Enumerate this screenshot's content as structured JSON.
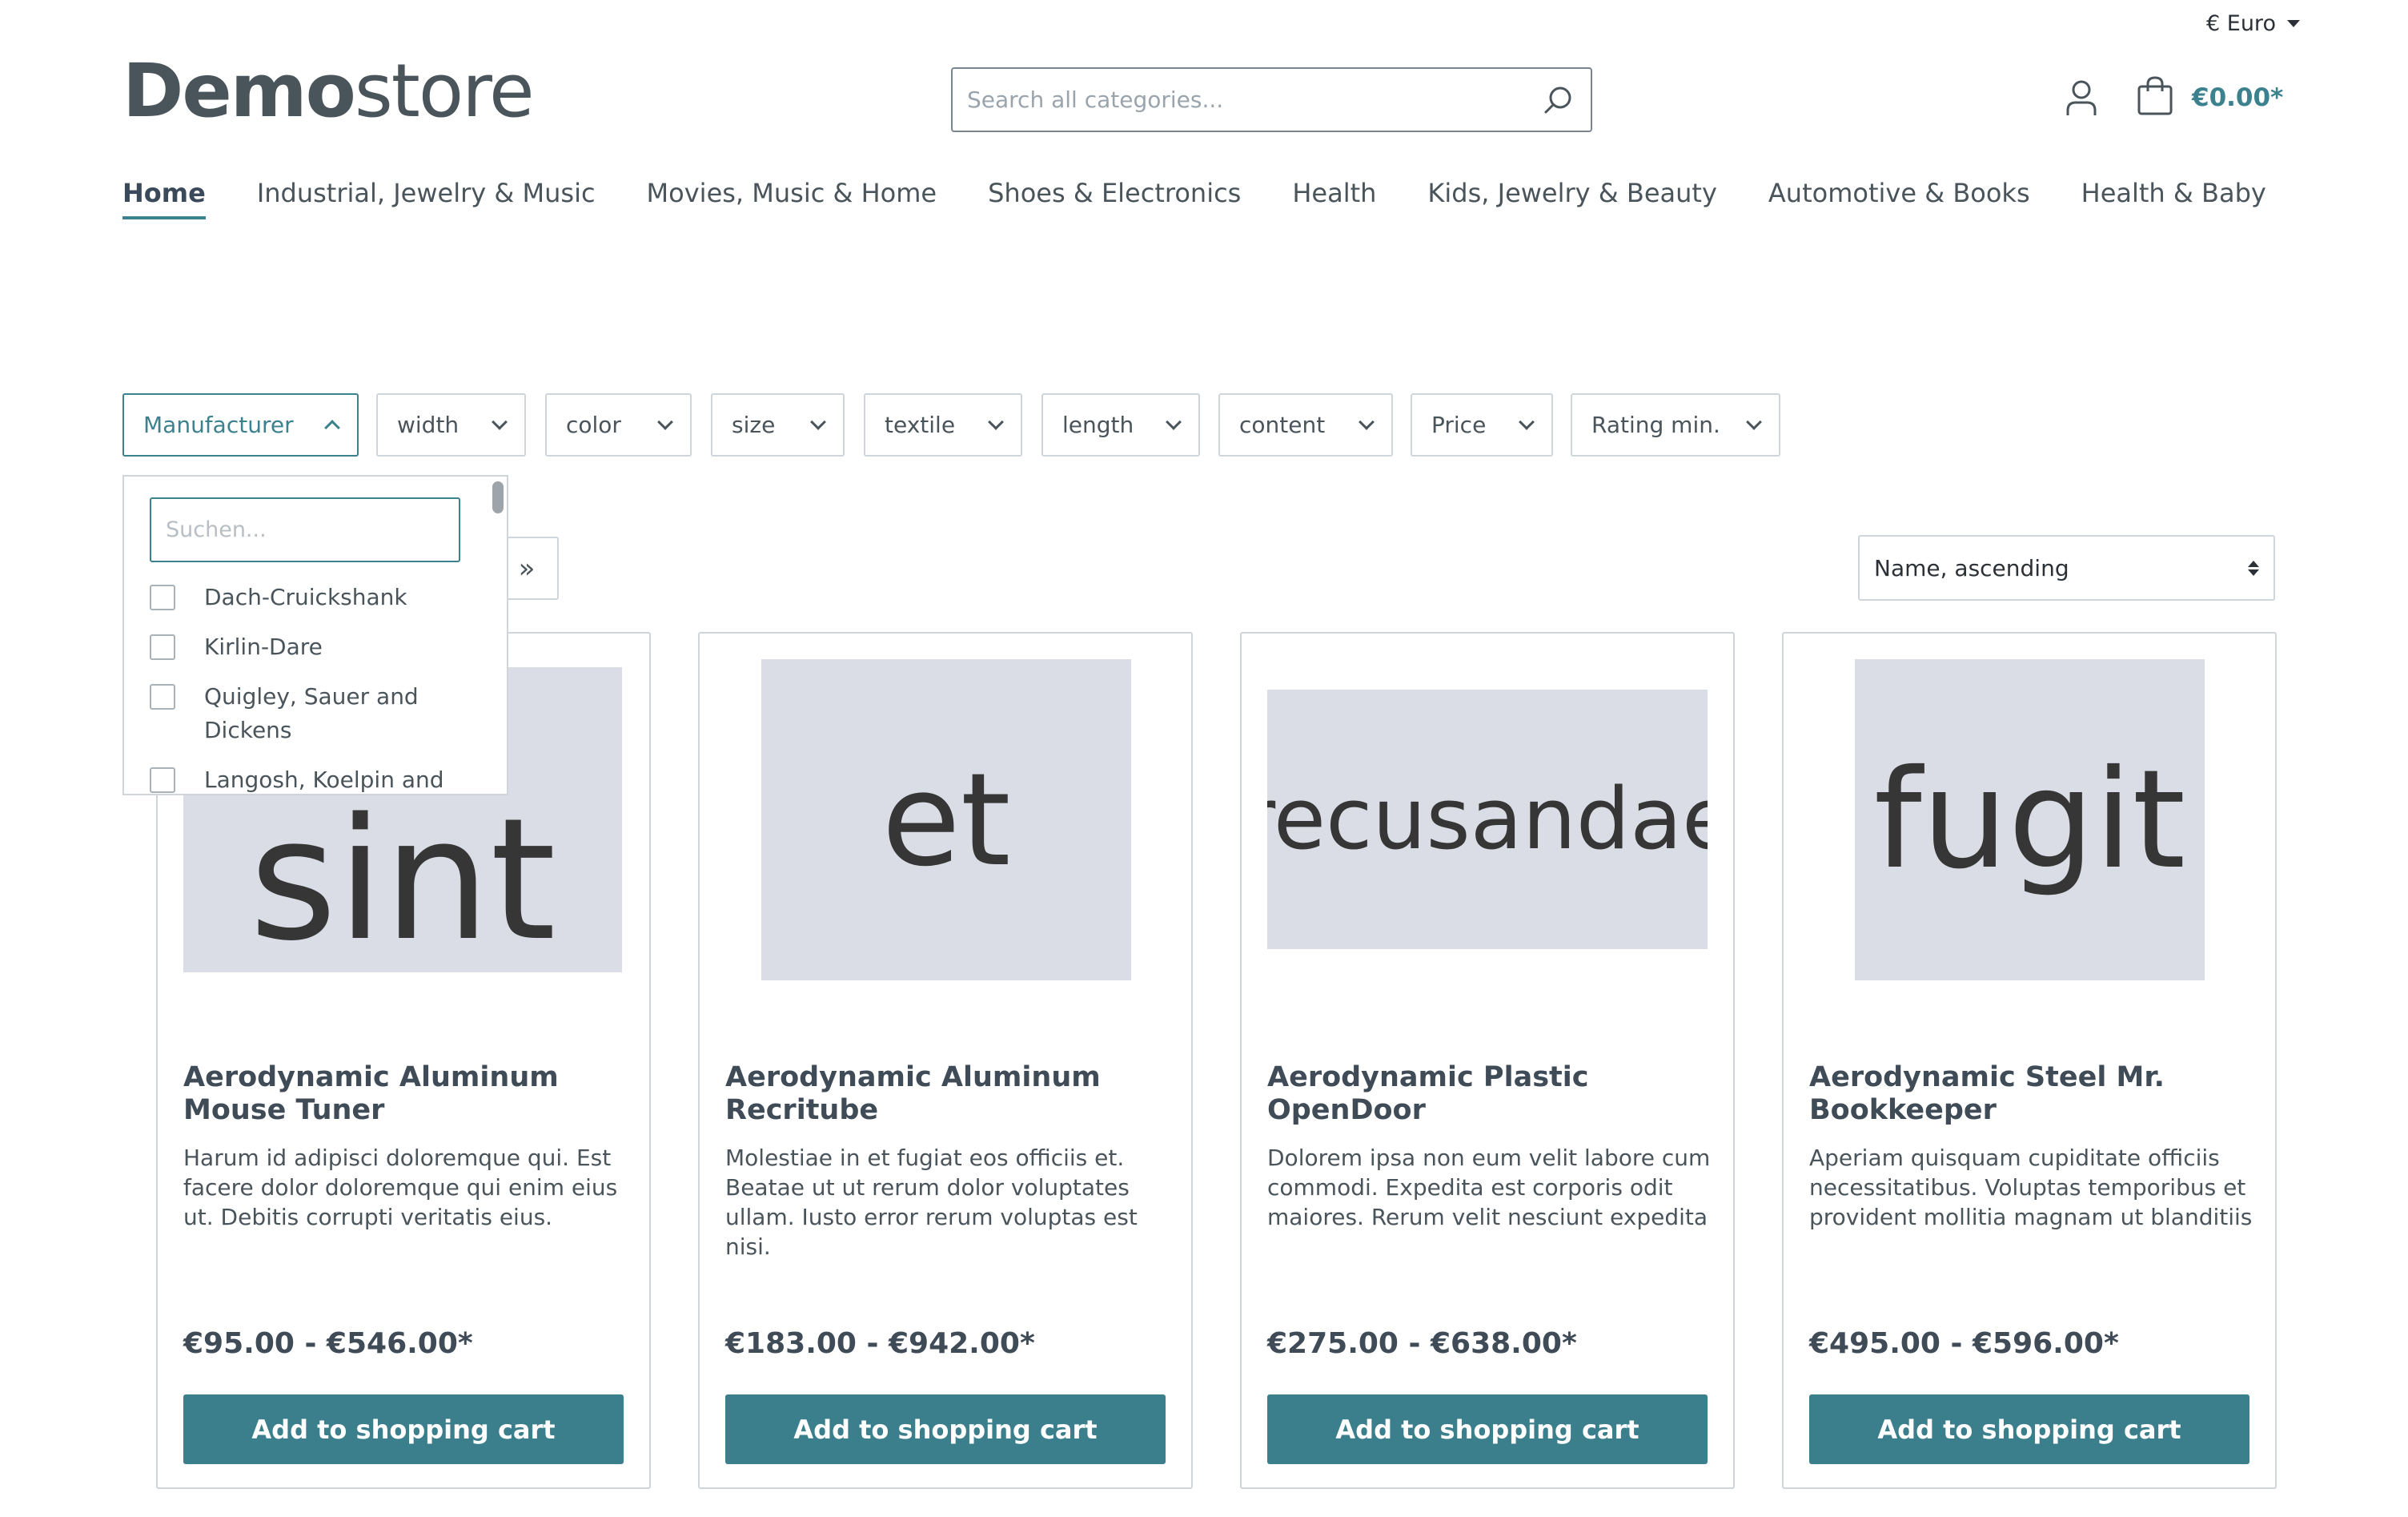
{
  "currency": {
    "label": "€ Euro"
  },
  "logo": {
    "bold": "Demo",
    "light": "store"
  },
  "search": {
    "placeholder": "Search all categories..."
  },
  "cart": {
    "total": "€0.00*"
  },
  "nav": {
    "items": [
      {
        "label": "Home",
        "active": true
      },
      {
        "label": "Industrial, Jewelry & Music"
      },
      {
        "label": "Movies, Music & Home"
      },
      {
        "label": "Shoes & Electronics"
      },
      {
        "label": "Health"
      },
      {
        "label": "Kids, Jewelry & Beauty"
      },
      {
        "label": "Automotive & Books"
      },
      {
        "label": "Health & Baby"
      }
    ]
  },
  "filters": [
    {
      "label": "Manufacturer",
      "open": true
    },
    {
      "label": "width"
    },
    {
      "label": "color"
    },
    {
      "label": "size"
    },
    {
      "label": "textile"
    },
    {
      "label": "length"
    },
    {
      "label": "content"
    },
    {
      "label": "Price"
    },
    {
      "label": "Rating min."
    }
  ],
  "manufacturer_dropdown": {
    "search_placeholder": "Suchen...",
    "options": [
      "Dach-Cruickshank",
      "Kirlin-Dare",
      "Quigley, Sauer and Dickens",
      "Langosh, Koelpin and"
    ]
  },
  "pager": {
    "next_label": "»"
  },
  "sorting": {
    "selected": "Name, ascending"
  },
  "products": [
    {
      "image_text": "sint",
      "title": "Aerodynamic Aluminum Mouse Tuner",
      "description": "Harum id adipisci doloremque qui. Est facere dolor doloremque qui enim eius ut. Debitis corrupti veritatis eius.",
      "price": "€95.00 - €546.00*",
      "button": "Add to shopping cart"
    },
    {
      "image_text": "et",
      "title": "Aerodynamic Aluminum Recritube",
      "description": "Molestiae in et fugiat eos officiis et. Beatae ut ut rerum dolor voluptates ullam. Iusto error rerum voluptas est nisi.",
      "price": "€183.00 - €942.00*",
      "button": "Add to shopping cart"
    },
    {
      "image_text": "recusandae",
      "title": "Aerodynamic Plastic OpenDoor",
      "description": "Dolorem ipsa non eum velit labore cum commodi. Expedita est corporis odit maiores. Rerum velit nesciunt expedita",
      "price": "€275.00 - €638.00*",
      "button": "Add to shopping cart"
    },
    {
      "image_text": "fugit",
      "title": "Aerodynamic Steel Mr. Bookkeeper",
      "description": "Aperiam quisquam cupiditate officiis necessitatibus. Voluptas temporibus et provident mollitia magnam ut blanditiis",
      "price": "€495.00 - €596.00*",
      "button": "Add to shopping cart"
    }
  ]
}
